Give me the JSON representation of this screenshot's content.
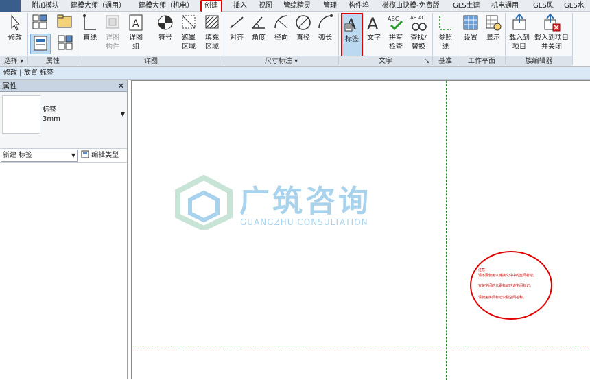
{
  "tabs": [
    "附加模块",
    "建模大师（通用）",
    "建模大师（机电）",
    "创建",
    "插入",
    "视图",
    "管综精灵",
    "管理",
    "构件坞",
    "橄榄山快模-免费版",
    "GLS土建",
    "机电通用",
    "GLS风",
    "GLS水"
  ],
  "ribbon": {
    "modify": "修改",
    "line": "直线",
    "detail_component": "详图构件",
    "detail_group": "详图组",
    "symbol": "符号",
    "masking_region": "遮罩区域",
    "filled_region": "填充区域",
    "aligned": "对齐",
    "angular": "角度",
    "radial": "径向",
    "diameter": "直径",
    "arc_length": "弧长",
    "label": "标签",
    "text": "文字",
    "spelling": "拼写检查",
    "find_replace": "查找/替换",
    "ref_line": "参照线",
    "set": "设置",
    "show": "显示",
    "load_project": "载入到项目",
    "load_close": "载入到项目并关闭",
    "panels": {
      "select": "选择",
      "properties": "属性",
      "detail": "详图",
      "dimension": "尺寸标注",
      "text": "文字",
      "datum": "基准",
      "workplane": "工作平面",
      "family_editor": "族编辑器"
    }
  },
  "context_bar": "修改 | 放置 标签",
  "properties": {
    "title": "属性",
    "type_name": "标签",
    "type_size": "3mm",
    "instance": "新建 标签",
    "edit_type": "编辑类型"
  },
  "watermark": {
    "cn": "广筑咨询",
    "en": "GUANGZHU CONSULTATION"
  },
  "note_lines": [
    "注意：",
    "请不要使用以链接文件中的空间标记。",
    "安装空间的元素标记时该空间标记。",
    "请使用房间标记识别空间名称。"
  ]
}
